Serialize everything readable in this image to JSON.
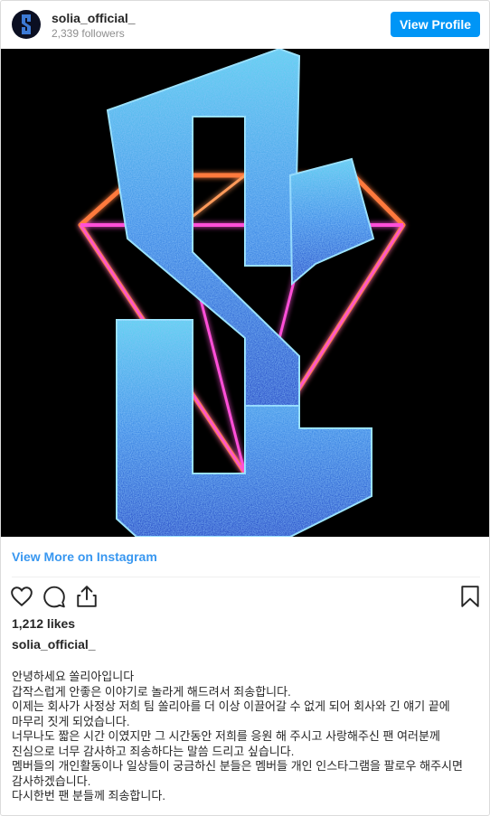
{
  "header": {
    "username": "solia_official_",
    "followers": "2,339 followers",
    "view_profile_label": "View Profile"
  },
  "post": {
    "view_more_label": "View More on Instagram",
    "likes": "1,212 likes",
    "caption_user": "solia_official_",
    "caption_lines": [
      "안녕하세요 쏠리아입니다",
      "갑작스럽게 안좋은 이야기로 놀라게 해드려서 죄송합니다.",
      "이제는 회사가 사정상 저희 팀 쏠리아를 더 이상 이끌어갈 수 없게 되어 회사와 긴 얘기 끝에 마무리 짓게 되었습니다.",
      "너무나도 짧은 시간 이였지만 그 시간동안 저희를 응원 해 주시고 사랑해주신 팬 여러분께 진심으로 너무 감사하고 죄송하다는 말씀 드리고 싶습니다.",
      "멤버들의 개인활동이나 일상들이 궁금하신 분들은 멤버들 개인 인스타그램을 팔로우 해주시면 감사하겠습니다.",
      "다시한번 팬 분들께 죄송합니다."
    ]
  },
  "icons": {
    "like": "heart-icon",
    "comment": "comment-icon",
    "share": "share-icon",
    "save": "bookmark-icon"
  },
  "colors": {
    "accent": "#0095f6",
    "link": "#3897f0",
    "neon_pink": "#ff4fd8",
    "neon_orange": "#ff7a3d",
    "glitter_blue": "#2e63d8",
    "glitter_cyan": "#5fd6f0"
  }
}
